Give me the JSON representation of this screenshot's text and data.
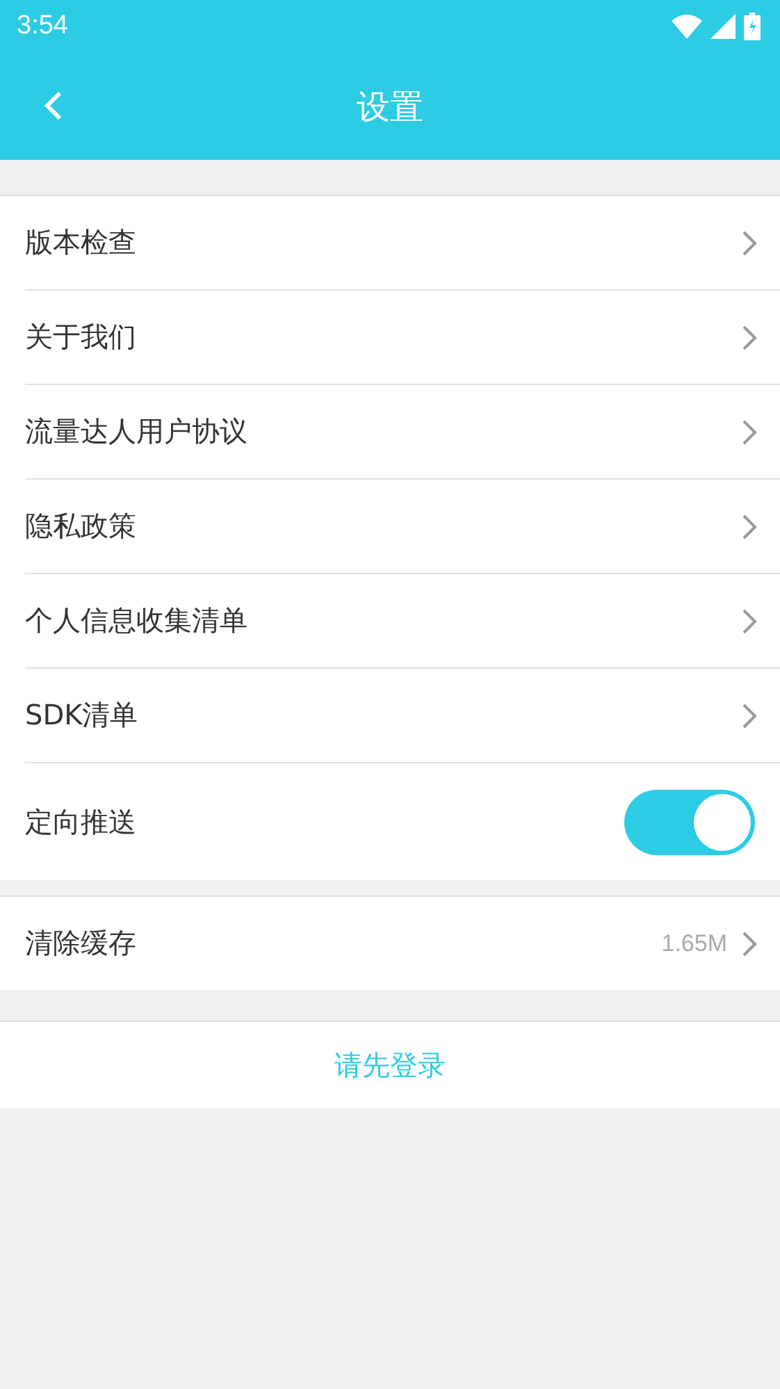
{
  "status_bar": {
    "time": "3:54"
  },
  "header": {
    "title": "设置"
  },
  "groups": [
    {
      "items": [
        {
          "kind": "link",
          "label": "版本检查"
        },
        {
          "kind": "link",
          "label": "关于我们"
        },
        {
          "kind": "link",
          "label": "流量达人用户协议"
        },
        {
          "kind": "link",
          "label": "隐私政策"
        },
        {
          "kind": "link",
          "label": "个人信息收集清单"
        },
        {
          "kind": "link",
          "label": "SDK清单"
        },
        {
          "kind": "toggle",
          "label": "定向推送",
          "on": true
        }
      ]
    },
    {
      "items": [
        {
          "kind": "value",
          "label": "清除缓存",
          "value": "1.65M"
        }
      ]
    }
  ],
  "login_button": "请先登录"
}
